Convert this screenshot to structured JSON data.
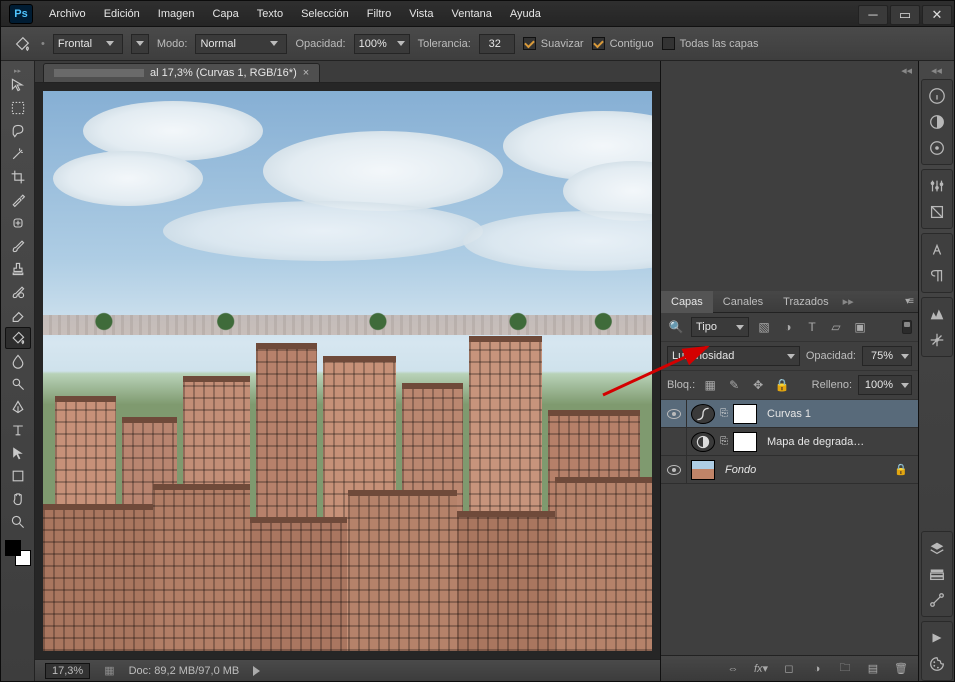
{
  "app": {
    "logo": "Ps"
  },
  "menu": [
    "Archivo",
    "Edición",
    "Imagen",
    "Capa",
    "Texto",
    "Selección",
    "Filtro",
    "Vista",
    "Ventana",
    "Ayuda"
  ],
  "options": {
    "preset_label": "Frontal",
    "mode_label": "Modo:",
    "mode_value": "Normal",
    "opacity_label": "Opacidad:",
    "opacity_value": "100%",
    "tolerance_label": "Tolerancia:",
    "tolerance_value": "32",
    "antialias_label": "Suavizar",
    "contiguous_label": "Contiguo",
    "all_layers_label": "Todas las capas"
  },
  "doc": {
    "tab_title": "al 17,3% (Curvas 1, RGB/16*)",
    "zoom": "17,3%",
    "docsize": "Doc: 89,2 MB/97,0 MB"
  },
  "layers_panel": {
    "tabs": [
      "Capas",
      "Canales",
      "Trazados"
    ],
    "filter_label": "Tipo",
    "blend_mode": "Luminosidad",
    "opacity_label": "Opacidad:",
    "opacity_value": "75%",
    "lock_label": "Bloq.:",
    "fill_label": "Relleno:",
    "fill_value": "100%",
    "layers": [
      {
        "name": "Curvas 1",
        "kind": "adjustment-curves",
        "visible": true,
        "selected": true
      },
      {
        "name": "Mapa de degrada…",
        "kind": "adjustment-gradmap",
        "visible": false,
        "selected": false
      },
      {
        "name": "Fondo",
        "kind": "background",
        "visible": true,
        "selected": false,
        "locked": true
      }
    ]
  }
}
